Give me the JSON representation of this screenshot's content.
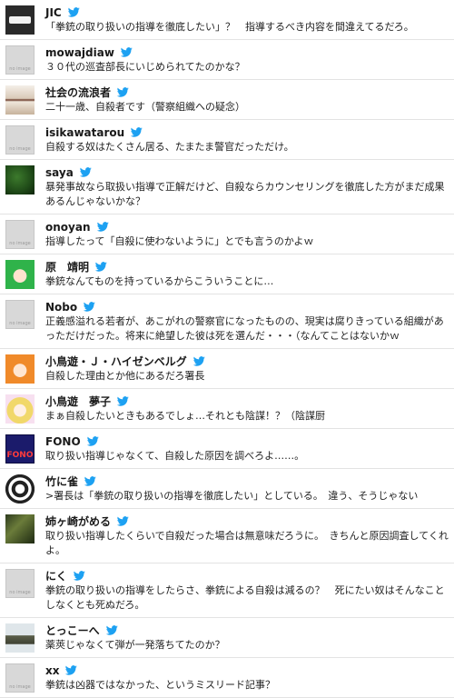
{
  "tweets": [
    {
      "name": "JIC",
      "text": "「拳銃の取り扱いの指導を徹底したい」？　指導するべき内容を間違えてるだろ。",
      "avatar": "dark"
    },
    {
      "name": "mowajdiaw",
      "text": "３０代の巡査部長にいじめられてたのかな？",
      "avatar": "noimg"
    },
    {
      "name": "社会の流浪者",
      "text": "二十一歳、自殺者です（警察組織への疑念）",
      "avatar": "branch"
    },
    {
      "name": "isikawatarou",
      "text": "自殺する奴はたくさん居る、たまたま警官だっただけ。",
      "avatar": "noimg"
    },
    {
      "name": "saya",
      "text": "暴発事故なら取扱い指導で正解だけど、自殺ならカウンセリングを徹底した方がまだ成果あるんじゃないかな？",
      "avatar": "leaf"
    },
    {
      "name": "onoyan",
      "text": "指導したって「自殺に使わないように」とでも言うのかよｗ",
      "avatar": "noimg"
    },
    {
      "name": "原　靖明",
      "text": "拳銃なんてものを持っているからこういうことに…",
      "avatar": "anime-green"
    },
    {
      "name": "Nobo",
      "text": "正義感溢れる若者が、あこがれの警察官になったものの、現実は腐りきっている組織があっただけだった。将来に絶望した彼は死を選んだ・・・（なんてことはないかｗ",
      "avatar": "noimg"
    },
    {
      "name": "小鳥遊・Ｊ・ハイゼンベルグ",
      "text": "自殺した理由とか他にあるだろ署長",
      "avatar": "anime-orange"
    },
    {
      "name": "小鳥遊　夢子",
      "text": "まぁ自殺したいときもあるでしょ…それとも陰謀！？（陰謀厨",
      "avatar": "anime-blonde"
    },
    {
      "name": "FONO",
      "text": "取り扱い指導じゃなくて、自殺した原因を調べろよ……。",
      "avatar": "fono"
    },
    {
      "name": "竹に雀",
      "text": ">署長は「拳銃の取り扱いの指導を徹底したい」としている。　違う、そうじゃない",
      "avatar": "seal"
    },
    {
      "name": "姉ヶ崎がめる",
      "text": "取り扱い指導したくらいで自殺だった場合は無意味だろうに。　きちんと原因調査してくれよ。",
      "avatar": "moss"
    },
    {
      "name": "にく",
      "text": "拳銃の取り扱いの指導をしたらさ、拳銃による自殺は減るの？　死にたい奴はそんなことしなくとも死ぬだろ。",
      "avatar": "noimg"
    },
    {
      "name": "とっこーへ",
      "text": "薬莢じゃなくて弾が一発落ちてたのか？",
      "avatar": "tank"
    },
    {
      "name": "xx",
      "text": "拳銃は凶器ではなかった、というミスリード記事？",
      "avatar": "noimg"
    }
  ],
  "icons": {
    "bird": "twitter-bird-icon"
  },
  "colors": {
    "bird": "#1da1f2",
    "divider": "#e3e3e3",
    "text": "#222222"
  }
}
